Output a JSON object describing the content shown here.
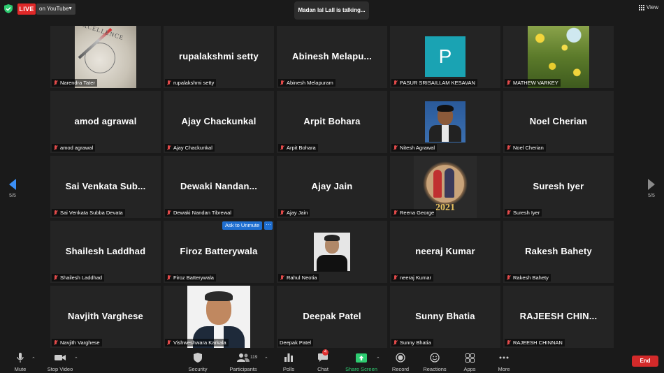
{
  "header": {
    "live_label": "LIVE",
    "stream_target": "on YouTube",
    "talking_indicator": "Madan lal Lall is talking...",
    "view_label": "View"
  },
  "pager": {
    "left_page": "5/5",
    "right_page": "5/5"
  },
  "tiles": [
    {
      "display": "",
      "label": "Narendra Tater",
      "pic": "compass",
      "pic_text": "XCELLENCE"
    },
    {
      "display": "rupalakshmi setty",
      "label": "rupalakshmi setty"
    },
    {
      "display": "Abinesh  Melapu...",
      "label": "Abinesh Melapuram"
    },
    {
      "display": "",
      "label": "PASUR SRISAILLAM KESAVAN",
      "pic": "letter",
      "pic_text": "P"
    },
    {
      "display": "",
      "label": "MATHEW VARKEY",
      "pic": "flowers"
    },
    {
      "display": "amod agrawal",
      "label": "amod agrawal"
    },
    {
      "display": "Ajay Chackunkal",
      "label": "Ajay Chackunkal"
    },
    {
      "display": "Arpit Bohara",
      "label": "Arpit Bohara"
    },
    {
      "display": "",
      "label": "Nitesh Agrawal",
      "pic": "man"
    },
    {
      "display": "Noel Cherian",
      "label": "Noel Cherian"
    },
    {
      "display": "Sai Venkata Sub...",
      "label": "Sai Venkata Subba Devata"
    },
    {
      "display": "Dewaki  Nandan...",
      "label": "Dewaki Nandan Tibrewal"
    },
    {
      "display": "Ajay Jain",
      "label": "Ajay Jain"
    },
    {
      "display": "",
      "label": "Reena George",
      "pic": "couple",
      "pic_text": "2021"
    },
    {
      "display": "Suresh Iyer",
      "label": "Suresh Iyer"
    },
    {
      "display": "Shailesh Laddhad",
      "label": "Shailesh Laddhad"
    },
    {
      "display": "Firoz Batterywala",
      "label": "Firoz Batterywala"
    },
    {
      "display": "",
      "label": "Rahul Neotia",
      "pic": "rahul"
    },
    {
      "display": "neeraj Kumar",
      "label": "neeraj Kumar"
    },
    {
      "display": "Rakesh Bahety",
      "label": "Rakesh Bahety"
    },
    {
      "display": "Navjith Varghese",
      "label": "Navjith Varghese"
    },
    {
      "display": "",
      "label": "Vishweshwara Karkala",
      "pic": "vish"
    },
    {
      "display": "Deepak Patel",
      "label": "Deepak Patel",
      "mic_on": true
    },
    {
      "display": "Sunny Bhatia",
      "label": "Sunny Bhatia"
    },
    {
      "display": "RAJEESH  CHIN...",
      "label": "RAJEESH CHINNAN"
    }
  ],
  "unmute": {
    "label": "Ask to Unmute",
    "more": "···"
  },
  "toolbar": {
    "mute": "Mute",
    "stop_video": "Stop Video",
    "security": "Security",
    "participants": "Participants",
    "participant_count": "119",
    "polls": "Polls",
    "chat": "Chat",
    "chat_badge": "4",
    "share_screen": "Share Screen",
    "record": "Record",
    "reactions": "Reactions",
    "apps": "Apps",
    "more": "More",
    "end": "End"
  },
  "colors": {
    "live": "#e02828",
    "accent": "#1f6fd1",
    "share_green": "#2ecc71",
    "end": "#d32a2a",
    "tile_bg": "#242424"
  }
}
